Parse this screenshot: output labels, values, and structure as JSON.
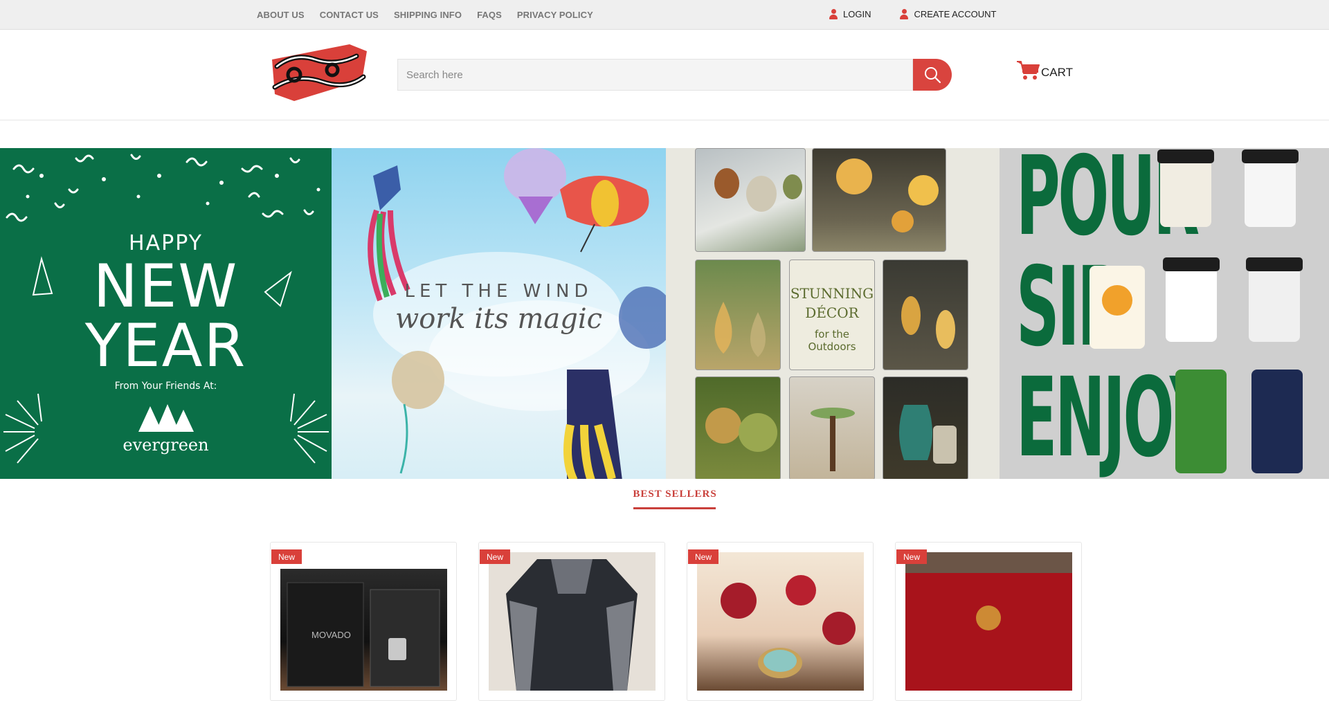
{
  "topbar": {
    "links": [
      "ABOUT US",
      "CONTACT US",
      "SHIPPING INFO",
      "FAQS",
      "PRIVACY POLICY"
    ],
    "login": "LOGIN",
    "create_account": "CREATE ACCOUNT"
  },
  "header": {
    "search_placeholder": "Search here",
    "cart_label": "CART"
  },
  "banner": {
    "slide1": {
      "line1": "HAPPY",
      "line2": "NEW",
      "line3": "YEAR",
      "from": "From Your Friends At:",
      "brand": "evergreen"
    },
    "slide2": {
      "line1": "LET THE WIND",
      "line2": "work its magic"
    },
    "slide3": {
      "line1": "STUNNING",
      "line2": "DÉCOR",
      "line3": "for the",
      "line4": "Outdoors"
    },
    "slide4": {
      "line1": "POUR",
      "line2": "SIP",
      "line3": "ENJOY"
    }
  },
  "best_sellers": {
    "title": "BEST SELLERS",
    "products": [
      {
        "badge": "New",
        "image": "watch-box"
      },
      {
        "badge": "New",
        "image": "jacket"
      },
      {
        "badge": "New",
        "image": "ring"
      },
      {
        "badge": "New",
        "image": "red-box"
      }
    ]
  },
  "colors": {
    "accent": "#d9403a",
    "topbar_bg": "#efefef",
    "evergreen_green": "#0a6f47"
  }
}
